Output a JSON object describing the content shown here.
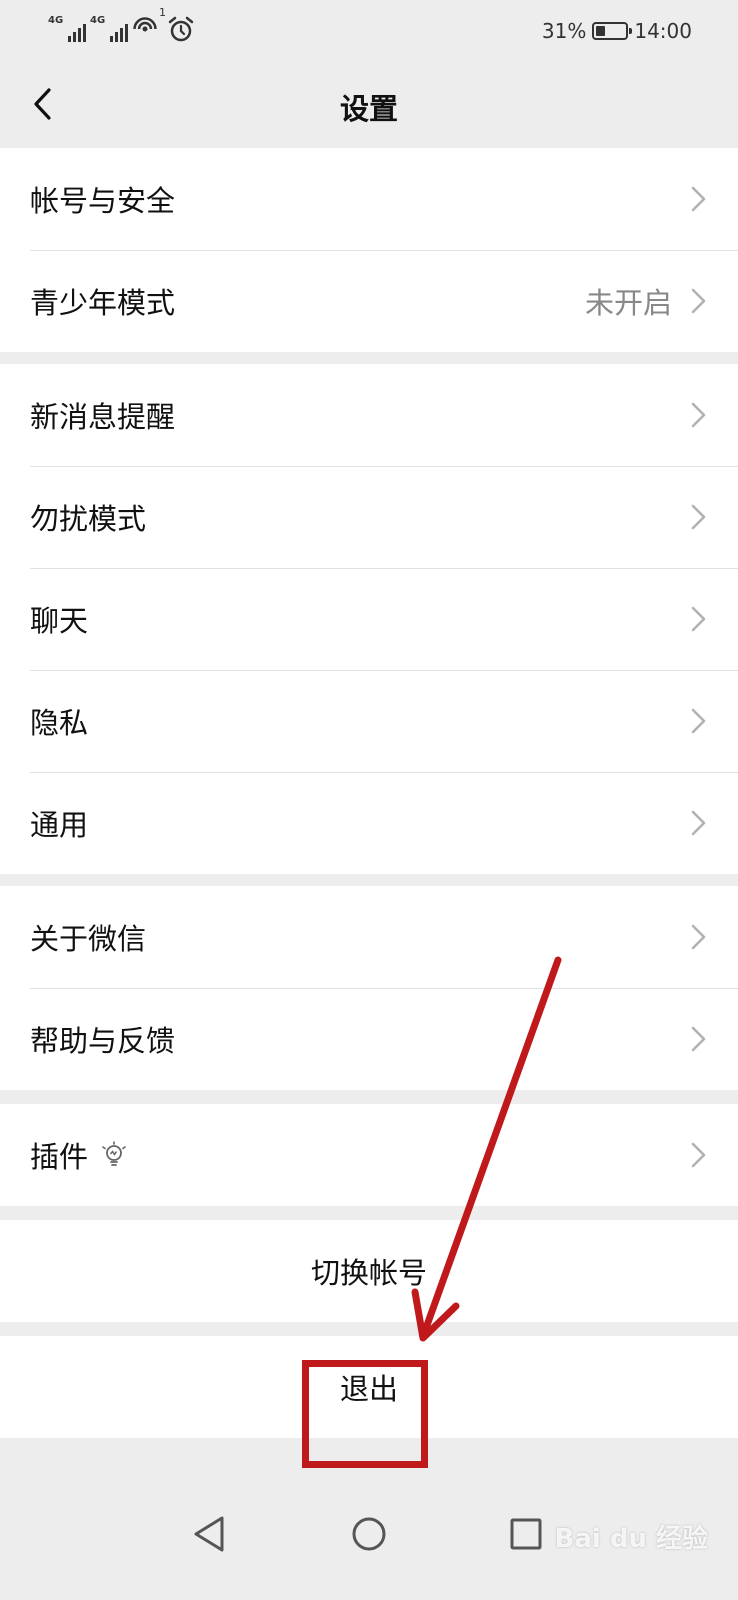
{
  "status_bar": {
    "signal1_label": "4G",
    "signal2_label": "4G",
    "wifi_badge": "1",
    "battery_percent": "31%",
    "battery_level": 0.31,
    "time": "14:00"
  },
  "nav": {
    "title": "设置"
  },
  "groups": [
    {
      "items": [
        {
          "label": "帐号与安全",
          "value": ""
        },
        {
          "label": "青少年模式",
          "value": "未开启"
        }
      ]
    },
    {
      "items": [
        {
          "label": "新消息提醒",
          "value": ""
        },
        {
          "label": "勿扰模式",
          "value": ""
        },
        {
          "label": "聊天",
          "value": ""
        },
        {
          "label": "隐私",
          "value": ""
        },
        {
          "label": "通用",
          "value": ""
        }
      ]
    },
    {
      "items": [
        {
          "label": "关于微信",
          "value": ""
        },
        {
          "label": "帮助与反馈",
          "value": ""
        }
      ]
    },
    {
      "items": [
        {
          "label": "插件",
          "value": ""
        }
      ]
    }
  ],
  "actions": {
    "switch_account": "切换帐号",
    "logout": "退出"
  },
  "colors": {
    "background": "#ededed",
    "annotation": "#c0191b"
  },
  "icons": {
    "back": "chevron-left-icon",
    "chevron": "chevron-right-icon",
    "plugin": "lightbulb-icon"
  },
  "watermark_text": "Bai du 经验"
}
